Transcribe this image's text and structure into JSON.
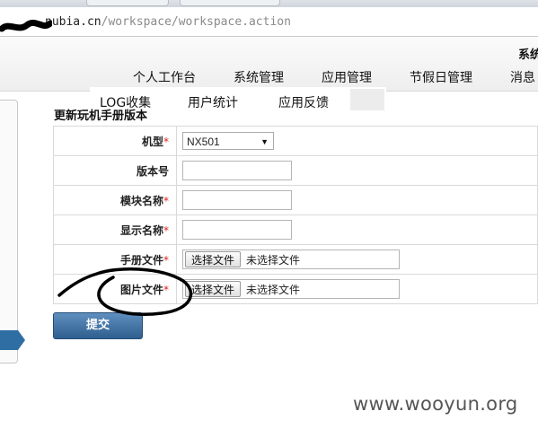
{
  "browser": {
    "url_host": "nubia.cn",
    "url_path": "/workspace/workspace.action"
  },
  "header": {
    "system_name": "系统"
  },
  "nav": {
    "row1": [
      "个人工作台",
      "系统管理",
      "应用管理",
      "节假日管理",
      "消息"
    ],
    "row2": [
      "LOG收集",
      "用户统计",
      "应用反馈"
    ]
  },
  "form": {
    "title": "更新玩机手册版本",
    "fields": [
      {
        "label": "机型",
        "required": true,
        "type": "select",
        "value": "NX501"
      },
      {
        "label": "版本号",
        "required": false,
        "type": "text",
        "value": ""
      },
      {
        "label": "模块名称",
        "required": true,
        "type": "text",
        "value": ""
      },
      {
        "label": "显示名称",
        "required": true,
        "type": "text",
        "value": ""
      },
      {
        "label": "手册文件",
        "required": true,
        "type": "file",
        "button": "选择文件",
        "status": "未选择文件"
      },
      {
        "label": "图片文件",
        "required": true,
        "type": "file",
        "button": "选择文件",
        "status": "未选择文件"
      }
    ],
    "submit_label": "提交"
  },
  "watermark": "www.wooyun.org",
  "colors": {
    "required_mark": "#e02020",
    "submit_bg": "#3b6a99",
    "sidebar_accent": "#2f6ea3"
  }
}
